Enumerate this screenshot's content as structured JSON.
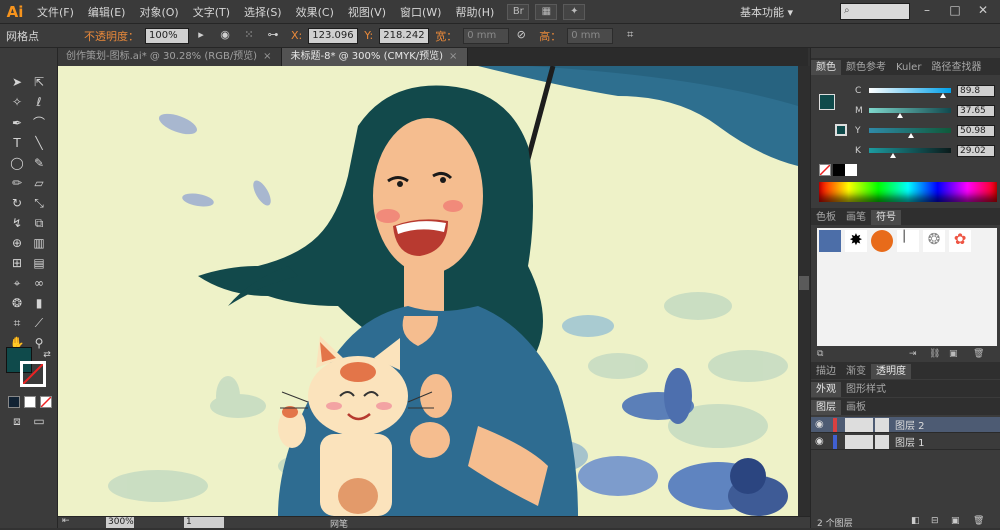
{
  "app": {
    "logo": "Ai"
  },
  "menus": [
    "文件(F)",
    "编辑(E)",
    "对象(O)",
    "文字(T)",
    "选择(S)",
    "效果(C)",
    "视图(V)",
    "窗口(W)",
    "帮助(H)"
  ],
  "workspace": {
    "label": "基本功能"
  },
  "control": {
    "selection_label": "网格点",
    "opacity_label": "不透明度：",
    "opacity_value": "100%",
    "x_label": "X:",
    "x_value": "123.096",
    "y_label": "Y:",
    "y_value": "218.242",
    "w_label": "宽：",
    "w_value": "0 mm",
    "h_label": "高：",
    "h_value": "0 mm"
  },
  "tabs": [
    {
      "label": "创作策划-图标.ai* @ 30.28% (RGB/预览)",
      "close": "×",
      "active": false
    },
    {
      "label": "未标题-8* @ 300% (CMYK/预览)",
      "close": "×",
      "active": true
    }
  ],
  "color_panel": {
    "tabs": [
      "颜色",
      "颜色参考",
      "Kuler",
      "路径查找器"
    ],
    "channels": [
      {
        "label": "C",
        "value": "89.8",
        "fraction": 0.898,
        "grad_from": "#ffffff",
        "grad_to": "#00a0e9"
      },
      {
        "label": "M",
        "value": "37.65",
        "fraction": 0.3765,
        "grad_from": "#7fd7cc",
        "grad_to": "#114a4f"
      },
      {
        "label": "Y",
        "value": "50.98",
        "fraction": 0.5098,
        "grad_from": "#2f8aa8",
        "grad_to": "#0f5a3a"
      },
      {
        "label": "K",
        "value": "29.02",
        "fraction": 0.2902,
        "grad_from": "#1c9ba0",
        "grad_to": "#0a1a1a"
      }
    ],
    "fill_color": "#0f4a4b"
  },
  "symbols_panel": {
    "tabs": [
      "色板",
      "画笔",
      "符号"
    ]
  },
  "transparency_panel": {
    "tabs": [
      "描边",
      "渐变",
      "透明度"
    ]
  },
  "appearance_panel": {
    "tabs": [
      "外观",
      "图形样式"
    ]
  },
  "layers_panel": {
    "tabs": [
      "图层",
      "画板"
    ],
    "layers": [
      {
        "name": "图层 2",
        "color": "#d94040",
        "selected": true
      },
      {
        "name": "图层 1",
        "color": "#4060d0",
        "selected": false
      }
    ],
    "footer": "2 个图层"
  },
  "status": {
    "zoom": "300%",
    "page": "1",
    "tool": "网笔"
  },
  "colors": {
    "hair": "#12494b",
    "skin": "#f5bd8f",
    "umbrella": "#2e6f8f",
    "shirt": "#2e6c91",
    "canvas_bg": "#eef2c8"
  }
}
